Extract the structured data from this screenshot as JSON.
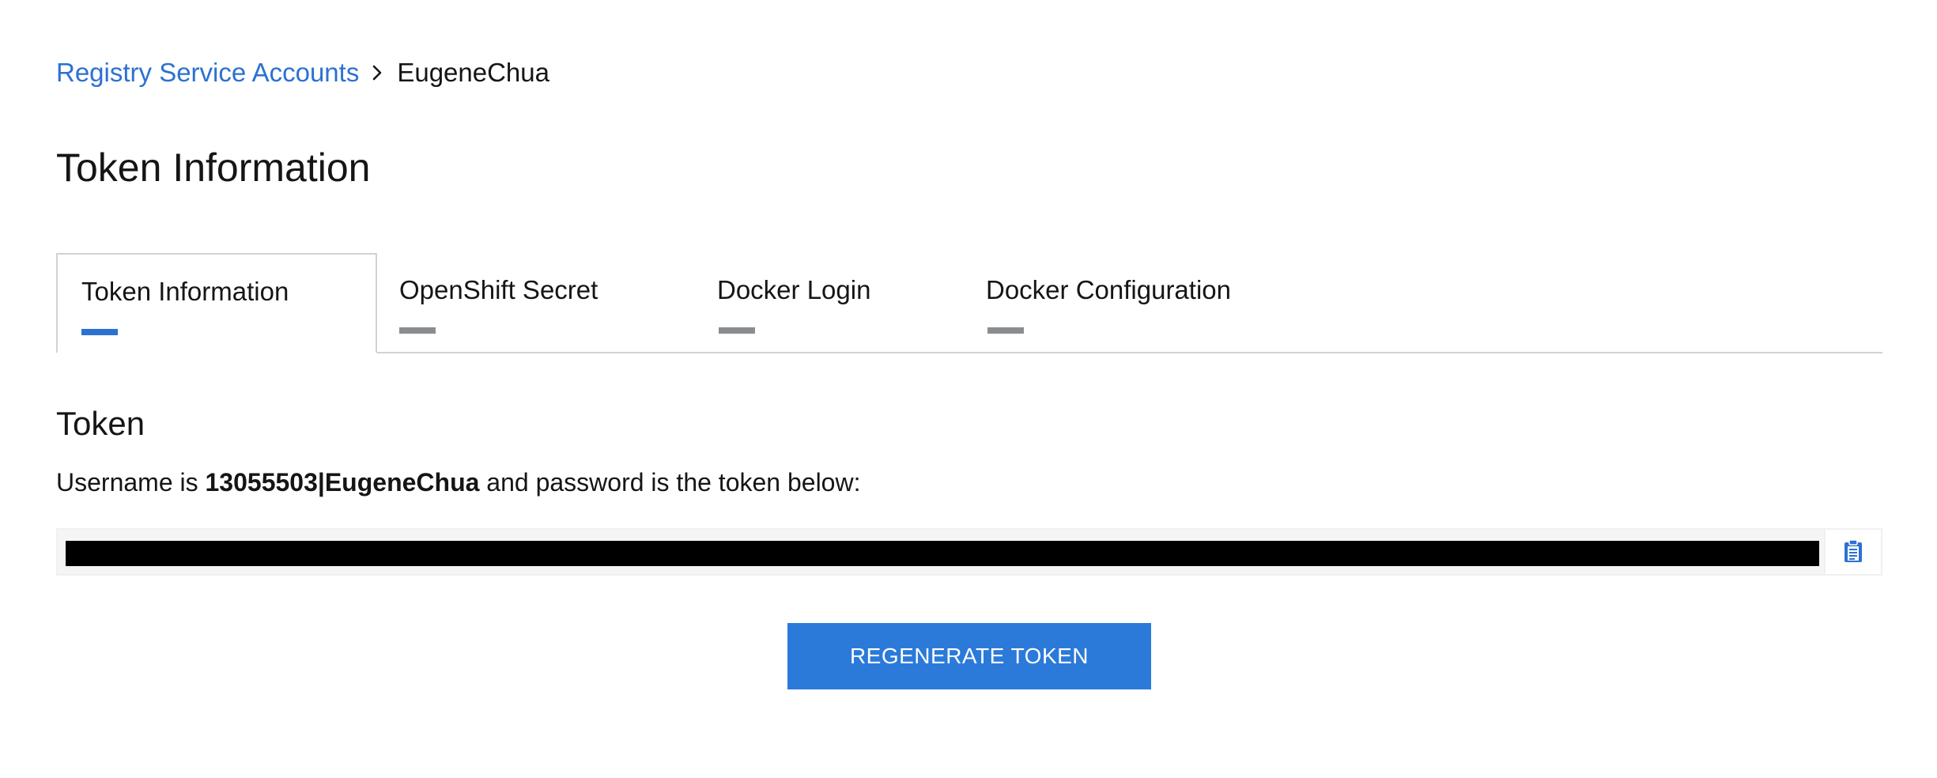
{
  "breadcrumb": {
    "parent_label": "Registry Service Accounts",
    "current_label": "EugeneChua"
  },
  "page": {
    "title": "Token Information"
  },
  "tabs": [
    {
      "label": "Token Information",
      "active": true
    },
    {
      "label": "OpenShift Secret",
      "active": false
    },
    {
      "label": "Docker Login",
      "active": false
    },
    {
      "label": "Docker Configuration",
      "active": false
    }
  ],
  "token_section": {
    "title": "Token",
    "username_prefix": "Username is ",
    "username": "13055503|EugeneChua",
    "username_suffix": " and password is the token below:",
    "token_value": "",
    "copy_icon": "clipboard-icon"
  },
  "actions": {
    "regenerate_label": "REGENERATE TOKEN"
  },
  "colors": {
    "link": "#2b71d2",
    "primary_button": "#2b7ad9",
    "active_tab_indicator": "#2b71d2",
    "inactive_tab_indicator": "#8a8d90"
  }
}
